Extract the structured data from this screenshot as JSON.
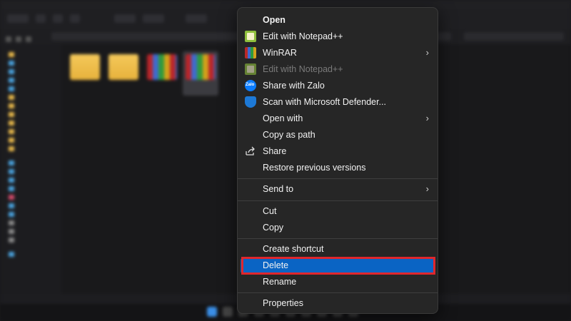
{
  "menu": {
    "items": [
      {
        "label": "Open",
        "bold": true
      },
      {
        "label": "Edit with Notepad++",
        "icon": "notepadpp-icon"
      },
      {
        "label": "WinRAR",
        "icon": "winrar-icon",
        "submenu": true
      },
      {
        "label": "Edit with Notepad++",
        "icon": "notepadpp-icon",
        "disabled": true
      },
      {
        "label": "Share with Zalo",
        "icon": "zalo-icon"
      },
      {
        "label": "Scan with Microsoft Defender...",
        "icon": "defender-shield-icon"
      },
      {
        "label": "Open with",
        "submenu": true
      },
      {
        "label": "Copy as path"
      },
      {
        "label": "Share",
        "icon": "share-icon"
      },
      {
        "label": "Restore previous versions"
      },
      {
        "label": "Send to",
        "submenu": true
      },
      {
        "label": "Cut"
      },
      {
        "label": "Copy"
      },
      {
        "label": "Create shortcut"
      },
      {
        "label": "Delete",
        "highlighted": true
      },
      {
        "label": "Rename"
      },
      {
        "label": "Properties"
      }
    ],
    "zalo_icon_text": "Zalo",
    "chevron": "›"
  },
  "colors": {
    "highlight": "#0a64c4",
    "annotation_box": "#e0262c",
    "menu_bg": "#262626"
  }
}
